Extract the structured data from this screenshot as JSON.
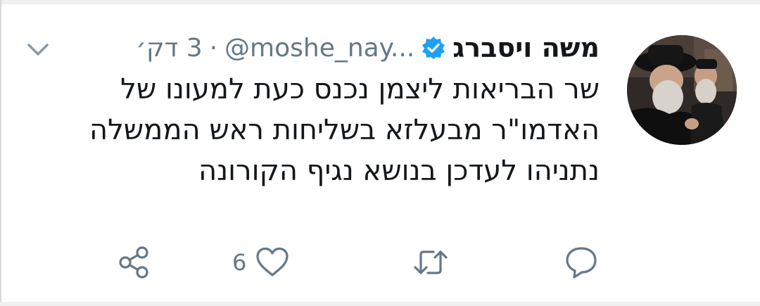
{
  "tweet": {
    "author_name": "משה ויסברג",
    "handle": "@moshe_nay...",
    "separator": "·",
    "time": "3 דק׳",
    "text_lines": [
      "שר הבריאות ליצמן נכנס כעת למעונו של",
      "האדמו\"ר מבעלזא בשליחות ראש הממשלה",
      "נתניהו לעדכן בנושא נגיף הקורונה"
    ]
  },
  "actions": {
    "reply_icon": "reply-bubble-icon",
    "retweet_icon": "retweet-icon",
    "like_icon": "heart-icon",
    "like_count": "6",
    "share_icon": "share-icon"
  },
  "colors": {
    "text_primary": "#14171a",
    "text_secondary": "#657786",
    "verified_blue": "#1da1f2",
    "icon_gray": "#657786"
  }
}
